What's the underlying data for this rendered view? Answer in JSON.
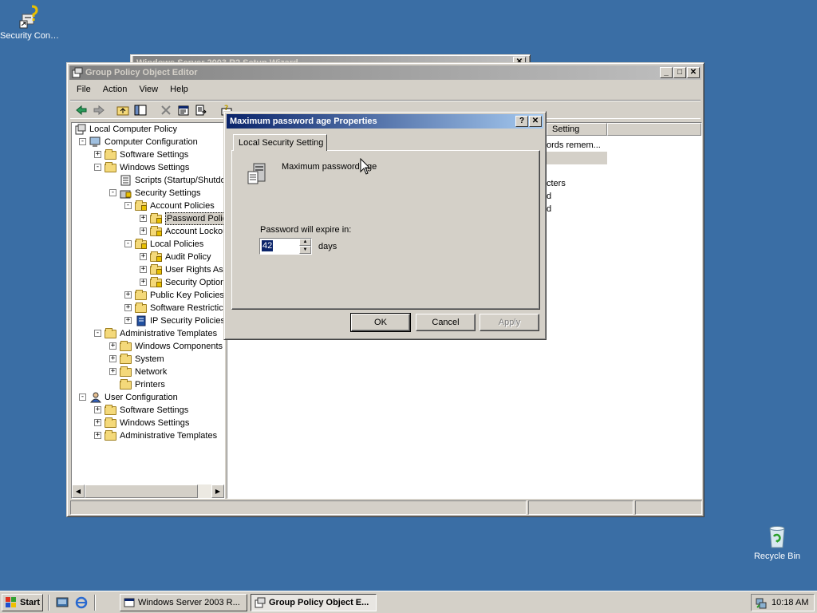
{
  "desktop": {
    "icons": [
      {
        "label": "Security Configurati..."
      },
      {
        "label": "Recycle Bin"
      }
    ]
  },
  "bg_window": {
    "title": "Windows Server 2003 R2 Setup Wizard"
  },
  "gpo_window": {
    "title": "Group Policy Object Editor",
    "menu": [
      "File",
      "Action",
      "View",
      "Help"
    ],
    "tree": [
      {
        "label": "Local Computer Policy"
      },
      {
        "label": "Computer Configuration"
      },
      {
        "label": "Software Settings"
      },
      {
        "label": "Windows Settings"
      },
      {
        "label": "Scripts (Startup/Shutdo"
      },
      {
        "label": "Security Settings"
      },
      {
        "label": "Account Policies"
      },
      {
        "label": "Password Polic"
      },
      {
        "label": "Account Lockou"
      },
      {
        "label": "Local Policies"
      },
      {
        "label": "Audit Policy"
      },
      {
        "label": "User Rights As"
      },
      {
        "label": "Security Option"
      },
      {
        "label": "Public Key Policies"
      },
      {
        "label": "Software Restrictic"
      },
      {
        "label": "IP Security Policies"
      },
      {
        "label": "Administrative Templates"
      },
      {
        "label": "Windows Components"
      },
      {
        "label": "System"
      },
      {
        "label": "Network"
      },
      {
        "label": "Printers"
      },
      {
        "label": "User Configuration"
      },
      {
        "label": "Software Settings"
      },
      {
        "label": "Windows Settings"
      },
      {
        "label": "Administrative Templates"
      }
    ],
    "list": {
      "column_header": "Setting",
      "rows": [
        "ords remem...",
        "",
        "",
        "cters",
        "d",
        "d"
      ]
    }
  },
  "dialog": {
    "title": "Maximum password age Properties",
    "tab": "Local Security Setting",
    "policy_name": "Maximum password age",
    "expire_label": "Password will expire in:",
    "expire_value": "42",
    "days_label": "days",
    "ok": "OK",
    "cancel": "Cancel",
    "apply": "Apply"
  },
  "taskbar": {
    "start": "Start",
    "tasks": [
      {
        "label": "Windows Server 2003 R..."
      },
      {
        "label": "Group Policy Object E..."
      }
    ],
    "clock": "10:18 AM"
  }
}
